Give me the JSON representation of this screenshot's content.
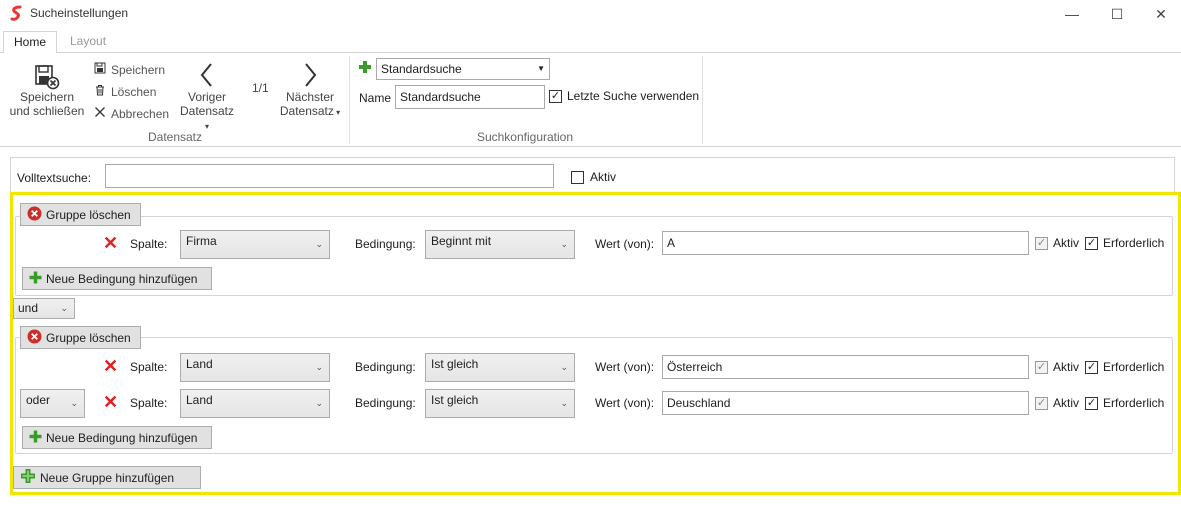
{
  "window": {
    "title": "Sucheinstellungen",
    "minimize": "—",
    "maximize": "☐",
    "close": "✕"
  },
  "tabs": [
    {
      "label": "Home",
      "active": true
    },
    {
      "label": "Layout",
      "active": false
    }
  ],
  "ribbon": {
    "save_close_label_1": "Speichern",
    "save_close_label_2": "und schließen",
    "save_label": "Speichern",
    "delete_label": "Löschen",
    "cancel_label": "Abbrechen",
    "prev_label_1": "Voriger",
    "prev_label_2": "Datensatz",
    "record_position": "1/1",
    "next_label_1": "Nächster",
    "next_label_2": "Datensatz",
    "group_datensatz": "Datensatz",
    "search_dropdown": "Standardsuche",
    "name_label": "Name",
    "name_value": "Standardsuche",
    "last_search_label": "Letzte Suche verwenden",
    "last_search_checked": true,
    "group_suchkonfiguration": "Suchkonfiguration"
  },
  "fulltext": {
    "label": "Volltextsuche:",
    "value": "",
    "active_label": "Aktiv",
    "active_checked": false
  },
  "groups": [
    {
      "delete_label": "Gruppe löschen",
      "conditions": [
        {
          "column_label": "Spalte:",
          "column": "Firma",
          "condition_label": "Bedingung:",
          "condition": "Beginnt mit",
          "value_label": "Wert (von):",
          "value": "A",
          "active_label": "Aktiv",
          "required_label": "Erforderlich"
        }
      ],
      "add_condition_label": "Neue Bedingung hinzufügen"
    },
    {
      "delete_label": "Gruppe löschen",
      "conditions": [
        {
          "column_label": "Spalte:",
          "column": "Land",
          "condition_label": "Bedingung:",
          "condition": "Ist gleich",
          "value_label": "Wert (von):",
          "value": "Österreich",
          "active_label": "Aktiv",
          "required_label": "Erforderlich"
        },
        {
          "connector": "oder",
          "column_label": "Spalte:",
          "column": "Land",
          "condition_label": "Bedingung:",
          "condition": "Ist gleich",
          "value_label": "Wert (von):",
          "value": "Deuschland",
          "active_label": "Aktiv",
          "required_label": "Erforderlich"
        }
      ],
      "add_condition_label": "Neue Bedingung hinzufügen"
    }
  ],
  "group_connector": "und",
  "add_group_label": "Neue Gruppe hinzufügen",
  "colors": {
    "highlight": "#f2e600",
    "accent_red": "#e02020",
    "accent_green": "#3a9b2a"
  }
}
